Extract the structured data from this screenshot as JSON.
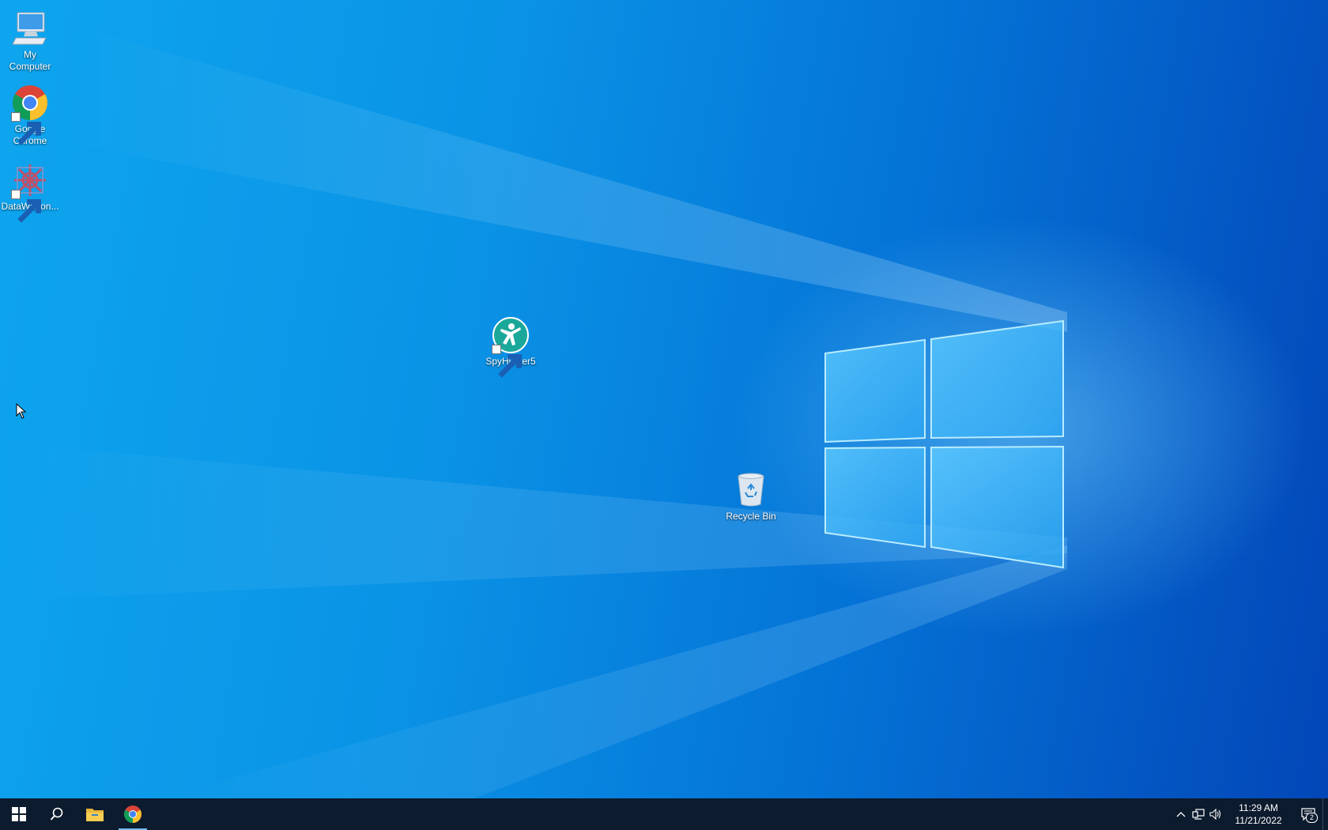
{
  "desktop": {
    "icons": [
      {
        "id": "my-computer",
        "label": "My\nComputer",
        "icon": "computer-icon"
      },
      {
        "id": "google-chrome",
        "label": "Google\nChrome",
        "icon": "chrome-icon"
      },
      {
        "id": "datawagon",
        "label": "DataWagon...",
        "icon": "datawagon-icon"
      },
      {
        "id": "spyhunter",
        "label": "SpyHunter5",
        "icon": "spyhunter-icon"
      },
      {
        "id": "recycle-bin",
        "label": "Recycle Bin",
        "icon": "recycle-bin-icon"
      }
    ]
  },
  "taskbar": {
    "buttons": [
      {
        "name": "start-button",
        "icon": "windows-logo-icon"
      },
      {
        "name": "search-button",
        "icon": "search-icon"
      },
      {
        "name": "file-explorer-button",
        "icon": "folder-icon"
      },
      {
        "name": "chrome-taskbar-button",
        "icon": "chrome-icon"
      }
    ],
    "tray": {
      "icons": [
        "chevron-up-icon",
        "network-icon",
        "volume-icon"
      ],
      "time": "11:29 AM",
      "date": "11/21/2022",
      "notification_count": "2"
    }
  },
  "colors": {
    "desktop_accent": "#0a93e6",
    "taskbar_bg": "#0d1b2e",
    "active_indicator": "#76b9ed"
  }
}
